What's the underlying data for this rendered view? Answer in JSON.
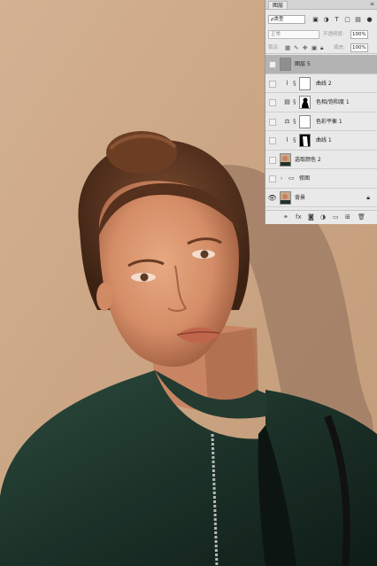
{
  "photo": {
    "description_icon": "portrait-photo"
  },
  "panel": {
    "tab_label": "图层",
    "menu_icon": "≡",
    "filter": {
      "kind_label": "ρ类型",
      "icons": [
        "image-filter-icon",
        "adjustment-filter-icon",
        "text-filter-icon",
        "shape-filter-icon",
        "smart-object-filter-icon"
      ]
    },
    "blend": {
      "mode": "正常",
      "opacity_label": "不透明度:",
      "opacity_value": "100%"
    },
    "lock": {
      "label": "锁定:",
      "fill_label": "填充:",
      "fill_value": "100%"
    },
    "layers": [
      {
        "name": "图层 5",
        "selected": true,
        "visible": false,
        "type": "pixel"
      },
      {
        "name": "曲线 2",
        "selected": false,
        "visible": false,
        "type": "curves"
      },
      {
        "name": "色相/饱和度 1",
        "selected": false,
        "visible": false,
        "type": "hue-saturation"
      },
      {
        "name": "色彩平衡 1",
        "selected": false,
        "visible": false,
        "type": "color-balance"
      },
      {
        "name": "曲线 1",
        "selected": false,
        "visible": false,
        "type": "curves"
      },
      {
        "name": "选取颜色 2",
        "selected": false,
        "visible": false,
        "type": "selective-color"
      },
      {
        "name": "修图",
        "selected": false,
        "visible": false,
        "type": "group"
      },
      {
        "name": "背景",
        "selected": false,
        "visible": true,
        "type": "background"
      }
    ]
  }
}
